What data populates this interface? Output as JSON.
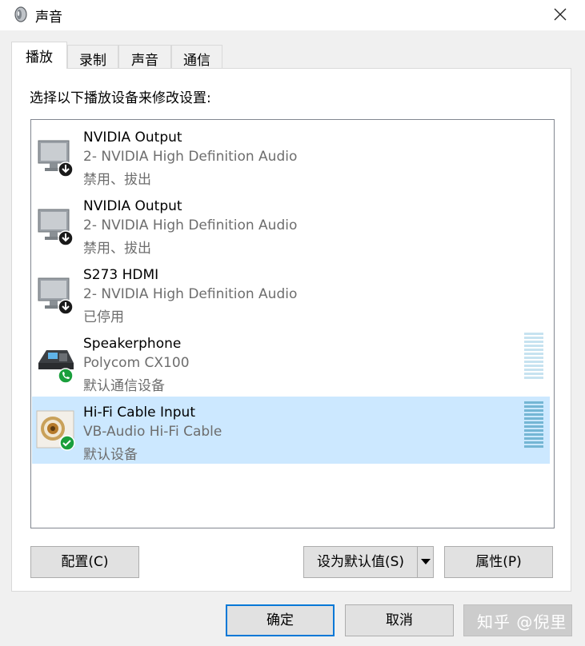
{
  "window": {
    "title": "声音"
  },
  "tabs": [
    {
      "label": "播放"
    },
    {
      "label": "录制"
    },
    {
      "label": "声音"
    },
    {
      "label": "通信"
    }
  ],
  "prompt": "选择以下播放设备来修改设置:",
  "devices": [
    {
      "name": "NVIDIA Output",
      "description": "2- NVIDIA High Definition Audio",
      "status": "禁用、拔出",
      "icon": "monitor-speaker-icon",
      "badge": "down-arrow-badge-icon"
    },
    {
      "name": "NVIDIA Output",
      "description": "2- NVIDIA High Definition Audio",
      "status": "禁用、拔出",
      "icon": "monitor-speaker-icon",
      "badge": "down-arrow-badge-icon"
    },
    {
      "name": "S273 HDMI",
      "description": "2- NVIDIA High Definition Audio",
      "status": "已停用",
      "icon": "monitor-speaker-icon",
      "badge": "down-arrow-badge-icon"
    },
    {
      "name": "Speakerphone",
      "description": "Polycom CX100",
      "status": "默认通信设备",
      "icon": "speakerphone-icon",
      "badge": "phone-badge-icon"
    },
    {
      "name": "Hi-Fi Cable Input",
      "description": "VB-Audio Hi-Fi Cable",
      "status": "默认设备",
      "icon": "rca-connector-icon",
      "badge": "check-badge-icon",
      "selected": true
    }
  ],
  "buttons": {
    "configure": "配置(C)",
    "set_default": "设为默认值(S)",
    "properties": "属性(P)",
    "ok": "确定",
    "cancel": "取消"
  },
  "watermark": "知乎 @倪里",
  "colors": {
    "selection": "#cce8ff",
    "accent": "#0078d7",
    "badge_green": "#1a9f3c",
    "meter_light": "#c7e3f0",
    "meter_dark": "#74b6d4"
  }
}
